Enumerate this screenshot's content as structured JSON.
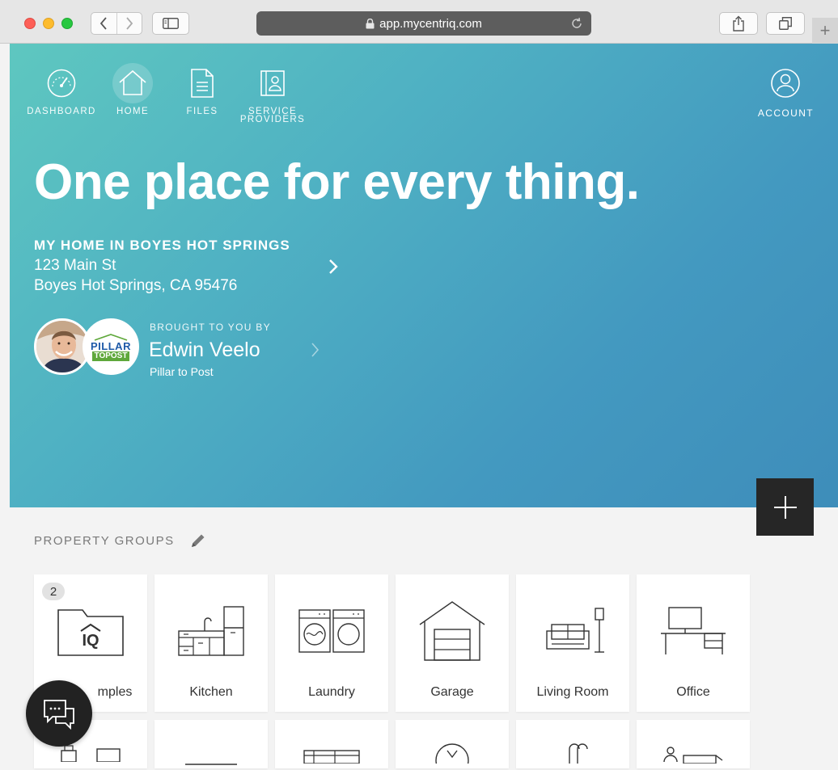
{
  "browser": {
    "url": "app.mycentriq.com",
    "new_tab_label": "+"
  },
  "nav": {
    "items": [
      {
        "label": "DASHBOARD"
      },
      {
        "label": "HOME"
      },
      {
        "label": "FILES"
      },
      {
        "label": "SERVICE PROVIDERS",
        "line1": "SERVICE",
        "line2": "PROVIDERS"
      }
    ],
    "account": "ACCOUNT"
  },
  "hero": {
    "title": "One place for every thing.",
    "property_name": "MY HOME IN BOYES HOT SPRINGS",
    "address_line1": "123 Main St",
    "address_line2": "Boyes Hot Springs, CA 95476",
    "brought_by": "BROUGHT TO YOU BY",
    "agent_name": "Edwin Veelo",
    "agent_company": "Pillar to Post",
    "logo_top": "PILLAR",
    "logo_bottom": "TOPOST"
  },
  "fab_label": "+",
  "groups": {
    "title": "PROPERTY GROUPS",
    "cards": [
      {
        "label": "Examples",
        "visible_label": "mples",
        "badge": "2",
        "icon": "folder-iq-icon"
      },
      {
        "label": "Kitchen",
        "icon": "kitchen-icon"
      },
      {
        "label": "Laundry",
        "icon": "laundry-icon"
      },
      {
        "label": "Garage",
        "icon": "garage-icon"
      },
      {
        "label": "Living Room",
        "icon": "living-room-icon"
      },
      {
        "label": "Office",
        "icon": "office-icon"
      }
    ]
  },
  "colors": {
    "hero_start": "#5ec7c0",
    "hero_end": "#3e8dba",
    "fab": "#262626",
    "page_bg": "#f3f3f3"
  }
}
